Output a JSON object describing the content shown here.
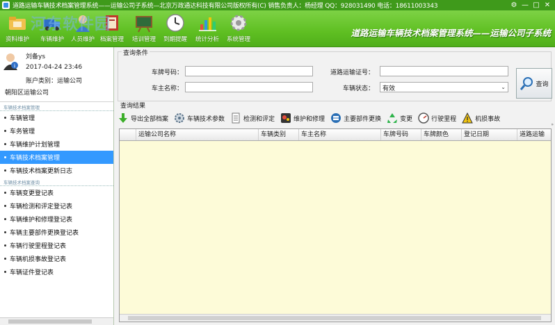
{
  "window": {
    "title": "道路运输车辆技术档案管理系统——运输公司子系统—北京万政通达科技有限公司版权所有(C) 销售负责人：杨经理 QQ：928031490 电话：18611003343",
    "controls": [
      "⚙",
      "—",
      "□",
      "✕"
    ]
  },
  "watermark": "河东软件园",
  "toolbar": {
    "items": [
      {
        "label": "资料维护",
        "icon": "folder-icon"
      },
      {
        "label": "车辆维护",
        "icon": "truck-icon"
      },
      {
        "label": "人员维护",
        "icon": "person-icon"
      },
      {
        "label": "档案管理",
        "icon": "archive-icon"
      },
      {
        "label": "培训管理",
        "icon": "board-icon"
      },
      {
        "label": "到期提醒",
        "icon": "clock-icon"
      },
      {
        "label": "统计分析",
        "icon": "chart-icon"
      },
      {
        "label": "系统管理",
        "icon": "gear-icon"
      }
    ],
    "banner": "道路运输车辆技术档案管理系统——运输公司子系统"
  },
  "user": {
    "name": "刘备ys",
    "datetime": "2017-04-24 23:46",
    "account_type": "账户类别：运输公司",
    "company": "朝阳区运输公司"
  },
  "sidebar": {
    "group1_title": "车辆技术档案管理",
    "group1": [
      "车辆管理",
      "车务管理",
      "车辆维护计划管理",
      "车辆技术档案管理",
      "车辆技术档案更新日志"
    ],
    "group2_title": "车辆技术档案查询",
    "group2": [
      "车辆变更登记表",
      "车辆检测和评定登记表",
      "车辆维护和修理登记表",
      "车辆主要部件更换登记表",
      "车辆行驶里程登记表",
      "车辆机损事故登记表",
      "车辆证件登记表"
    ]
  },
  "query": {
    "legend": "查询条件",
    "plate_label": "车牌号码：",
    "permit_label": "道路运输证号：",
    "owner_label": "车主名称：",
    "status_label": "车辆状态：",
    "plate_value": "",
    "permit_value": "",
    "owner_value": "",
    "status_value": "有效",
    "button_label": "查询"
  },
  "results": {
    "title": "查询结果",
    "actions": [
      {
        "label": "导出全部档案",
        "icon": "download-icon"
      },
      {
        "label": "车辆技术参数",
        "icon": "gear-icon"
      },
      {
        "label": "检测和评定",
        "icon": "document-icon"
      },
      {
        "label": "维护和修理",
        "icon": "wrench-icon"
      },
      {
        "label": "主要部件更换",
        "icon": "parts-icon"
      },
      {
        "label": "变更",
        "icon": "recycle-icon"
      },
      {
        "label": "行驶里程",
        "icon": "speedometer-icon"
      },
      {
        "label": "机损事故",
        "icon": "warning-icon"
      }
    ],
    "columns": [
      "",
      "运输公司名称",
      "车辆类别",
      "车主名称",
      "车牌号码",
      "车牌颜色",
      "登记日期",
      "道路运输"
    ]
  },
  "colors": {
    "titlebar": "#3f9a1b",
    "toolbar": "#5fbf22",
    "selected": "#3399ff",
    "grid_bg": "#fdfbd8"
  }
}
